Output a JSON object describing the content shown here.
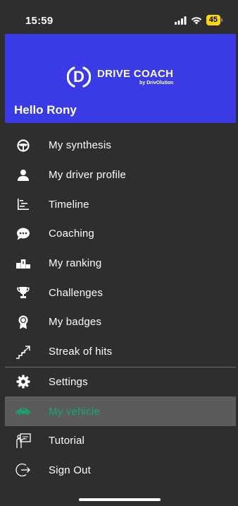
{
  "status_bar": {
    "time": "15:59",
    "battery": "45"
  },
  "header": {
    "logo_letter": "D",
    "logo_title": "DRIVE COACH",
    "logo_sub": "by DrivOlution",
    "greeting": "Hello Rony"
  },
  "menu": {
    "items": [
      {
        "label": "My synthesis",
        "icon": "steering-wheel-icon"
      },
      {
        "label": "My driver profile",
        "icon": "user-icon"
      },
      {
        "label": "Timeline",
        "icon": "timeline-icon"
      },
      {
        "label": "Coaching",
        "icon": "chat-bubble-icon"
      },
      {
        "label": "My ranking",
        "icon": "podium-icon"
      },
      {
        "label": "Challenges",
        "icon": "trophy-icon"
      },
      {
        "label": "My badges",
        "icon": "badge-icon"
      },
      {
        "label": "Streak of hits",
        "icon": "stairs-arrow-icon"
      }
    ],
    "items_bottom": [
      {
        "label": "Settings",
        "icon": "gear-icon"
      },
      {
        "label": "My vehicle",
        "icon": "car-icon",
        "active": true
      },
      {
        "label": "Tutorial",
        "icon": "presentation-icon"
      },
      {
        "label": "Sign Out",
        "icon": "sign-out-icon"
      }
    ]
  },
  "colors": {
    "header_bg": "#3a3be6",
    "menu_bg": "#2e2e2e",
    "active_bg": "#5b5b5b",
    "active_text": "#14a86c"
  }
}
